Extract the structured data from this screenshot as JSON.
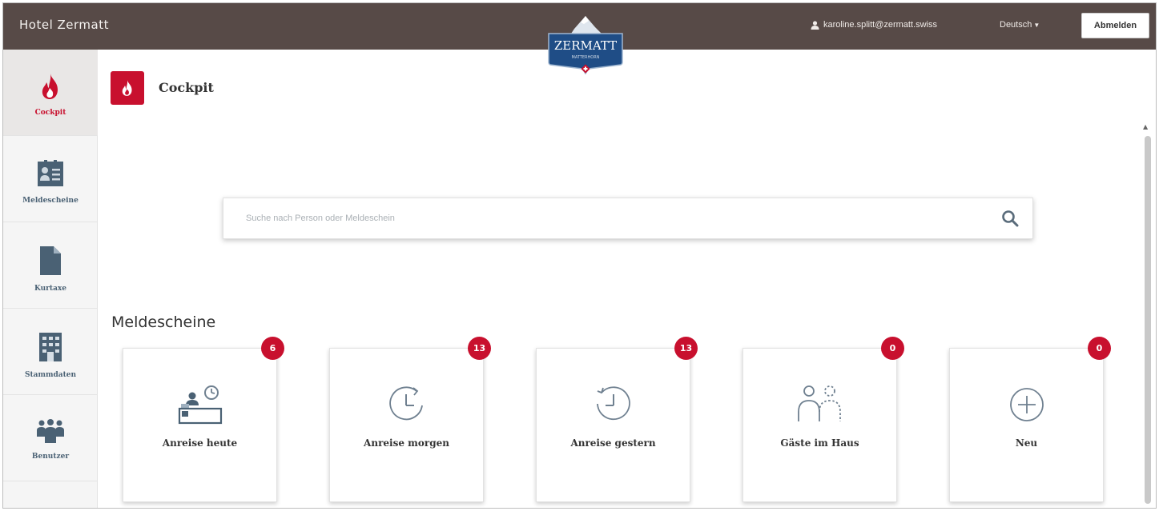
{
  "app": {
    "title": "Hotel Zermatt",
    "logo_text": "ZERMATT",
    "logo_subtext": "MATTERHORN"
  },
  "header": {
    "user_email": "karoline.splitt@zermatt.swiss",
    "language": "Deutsch",
    "logout_label": "Abmelden"
  },
  "sidebar": {
    "items": [
      {
        "label": "Cockpit",
        "icon": "flame-icon",
        "active": true
      },
      {
        "label": "Meldescheine",
        "icon": "id-card-icon",
        "active": false
      },
      {
        "label": "Kurtaxe",
        "icon": "document-icon",
        "active": false
      },
      {
        "label": "Stammdaten",
        "icon": "building-icon",
        "active": false
      },
      {
        "label": "Benutzer",
        "icon": "users-icon",
        "active": false
      }
    ]
  },
  "page": {
    "title": "Cockpit"
  },
  "search": {
    "placeholder": "Suche nach Person oder Meldeschein"
  },
  "section": {
    "title": "Meldescheine"
  },
  "cards": [
    {
      "label": "Anreise heute",
      "count": "6",
      "icon": "reception-desk-icon"
    },
    {
      "label": "Anreise morgen",
      "count": "13",
      "icon": "clock-forward-icon"
    },
    {
      "label": "Anreise gestern",
      "count": "13",
      "icon": "clock-history-icon"
    },
    {
      "label": "Gäste im Haus",
      "count": "0",
      "icon": "guests-icon"
    },
    {
      "label": "Neu",
      "count": "0",
      "icon": "plus-circle-icon"
    }
  ],
  "colors": {
    "topbar": "#574a47",
    "accent": "#c8102e",
    "sidebar_label": "#4a6174",
    "icon_blue": "#4a6174"
  }
}
